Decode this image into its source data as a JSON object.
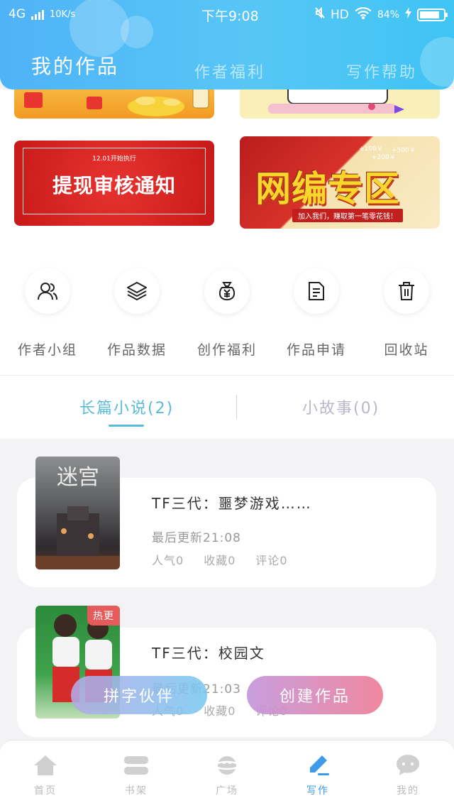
{
  "status_bar": {
    "network": "4G",
    "speed": "10K/s",
    "time": "下午9:08",
    "hd": "HD",
    "battery": "84%",
    "battery_level": 0.84
  },
  "top_tabs": [
    "我的作品",
    "作者福利",
    "写作帮助"
  ],
  "banners": {
    "notice_small": "12.01开始执行",
    "notice_title": "提现审核通知",
    "zone_title": "网编专区",
    "zone_sub": "加入我们，赚取第一笔零花钱！",
    "zone_money": [
      "+100￥",
      "+500￥",
      "+200￥"
    ]
  },
  "quick_actions": [
    {
      "label": "作者小组",
      "icon": "user-group-icon"
    },
    {
      "label": "作品数据",
      "icon": "layers-icon"
    },
    {
      "label": "创作福利",
      "icon": "money-bag-icon"
    },
    {
      "label": "作品申请",
      "icon": "document-icon"
    },
    {
      "label": "回收站",
      "icon": "trash-icon"
    }
  ],
  "works_tabs": {
    "long": "长篇小说(2)",
    "short": "小故事(0)"
  },
  "works": [
    {
      "cover_text": "迷宫",
      "title": "TF三代：噩梦游戏……",
      "updated": "最后更新21:08",
      "stats": [
        "人气0",
        "收藏0",
        "评论0"
      ]
    },
    {
      "badge": "热更",
      "title": "TF三代：校园文",
      "updated": "最后更新21:03",
      "stats": [
        "人气0",
        "收藏0",
        "评论0"
      ]
    }
  ],
  "floating_buttons": {
    "partner": "拼字伙伴",
    "create": "创建作品"
  },
  "bottom_nav": [
    {
      "label": "首页",
      "icon": "home-icon"
    },
    {
      "label": "书架",
      "icon": "bookshelf-icon"
    },
    {
      "label": "广场",
      "icon": "planet-icon"
    },
    {
      "label": "写作",
      "icon": "pen-icon"
    },
    {
      "label": "我的",
      "icon": "chat-bubble-icon"
    }
  ],
  "colors": {
    "header": "#4fb3f7",
    "tab_active": "#5abbd8",
    "nav_active": "#3d9bea"
  }
}
